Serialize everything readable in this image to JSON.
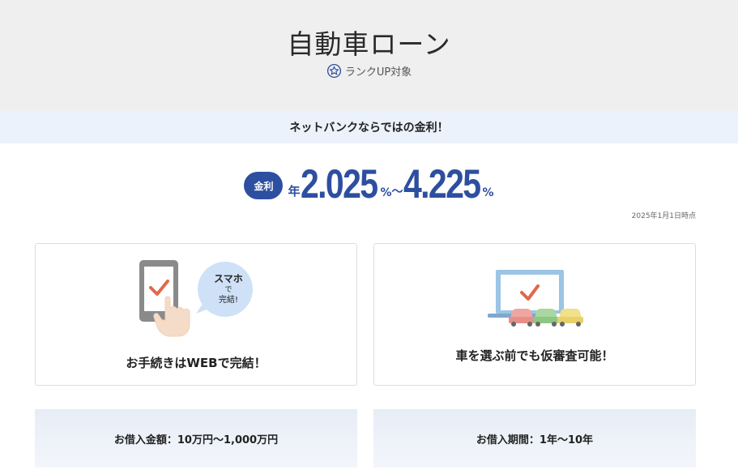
{
  "header": {
    "title": "自動車ローン",
    "rank_label": "ランクUP対象"
  },
  "band": {
    "text": "ネットバンクならではの金利！"
  },
  "rate": {
    "badge": "金利",
    "prefix": "年",
    "min": "2.025",
    "unit": "%",
    "separator": "～",
    "max": "4.225",
    "as_of": "2025年1月1日時点"
  },
  "features": [
    {
      "bubble_line1": "スマホ",
      "bubble_line2": "で",
      "bubble_line3": "完結!",
      "text": "お手続きはWEBで完結！"
    },
    {
      "text": "車を選ぶ前でも仮審査可能！"
    }
  ],
  "info": [
    {
      "text": "お借入金額：10万円～1,000万円"
    },
    {
      "text": "お借入期間：1年～10年"
    }
  ],
  "colors": {
    "brand": "#2d4fa0",
    "hero_bg": "#efefef",
    "band_bg": "#ecf2fb",
    "check": "#e0684b"
  }
}
